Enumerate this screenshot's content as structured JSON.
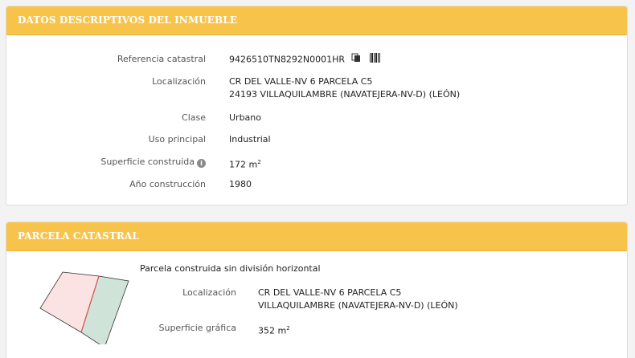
{
  "panel1": {
    "title": "DATOS DESCRIPTIVOS DEL INMUEBLE",
    "rows": {
      "referencia": {
        "label": "Referencia catastral",
        "value": "9426510TN8292N0001HR"
      },
      "localizacion": {
        "label": "Localización",
        "line1": "CR DEL VALLE-NV 6 PARCELA C5",
        "line2": "24193 VILLAQUILAMBRE (NAVATEJERA-NV-D) (LEÓN)"
      },
      "clase": {
        "label": "Clase",
        "value": "Urbano"
      },
      "uso": {
        "label": "Uso principal",
        "value": "Industrial"
      },
      "superficie": {
        "label": "Superficie construida",
        "value": "172 m",
        "unit_sup": "2"
      },
      "anio": {
        "label": "Año construcción",
        "value": "1980"
      }
    }
  },
  "panel2": {
    "title": "PARCELA CATASTRAL",
    "subtitle": "Parcela construida sin división horizontal",
    "rows": {
      "localizacion": {
        "label": "Localización",
        "line1": "CR DEL VALLE-NV 6 PARCELA C5",
        "line2": "VILLAQUILAMBRE (NAVATEJERA-NV-D) (LEÓN)"
      },
      "superficie": {
        "label": "Superficie gráfica",
        "value": "352 m",
        "unit_sup": "2"
      }
    }
  },
  "icons": {
    "copy": "copy-icon",
    "barcode": "barcode-icon",
    "info": "info-icon"
  },
  "colors": {
    "header_bg": "#f8c34a",
    "header_text": "#ffffff",
    "parcel_left_fill": "#fbe3e3",
    "parcel_right_fill": "#cfe3d9",
    "parcel_divider": "#d9534f"
  }
}
